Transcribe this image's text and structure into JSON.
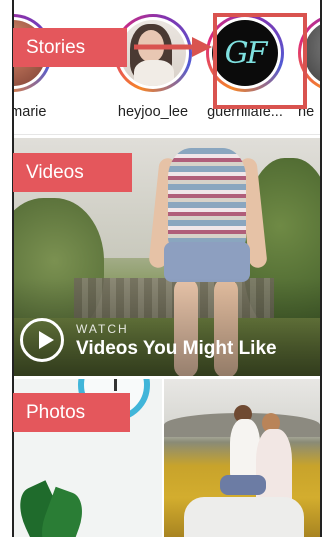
{
  "stories": {
    "items": [
      {
        "name": "_.siamarie"
      },
      {
        "name": "heyjoo_lee"
      },
      {
        "name": "guerrillafe..."
      },
      {
        "name": "he"
      }
    ]
  },
  "annotations": {
    "stories_label": "Stories",
    "videos_label": "Videos",
    "photos_label": "Photos",
    "highlight_color": "#d9534f",
    "tag_color": "#e4575c"
  },
  "video": {
    "kicker": "WATCH",
    "title": "Videos You Might Like"
  },
  "logo": {
    "text": "GF"
  }
}
